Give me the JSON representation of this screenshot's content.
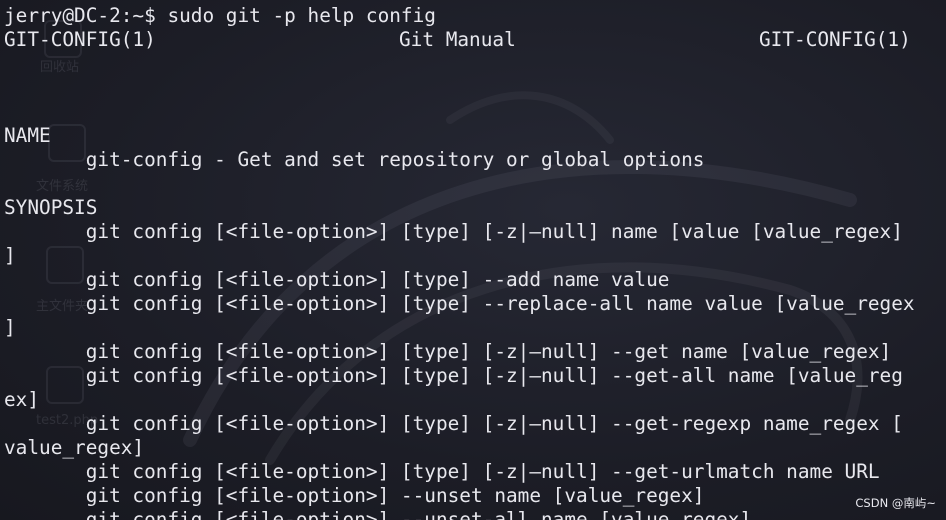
{
  "terminal": {
    "prompt_line": "jerry@DC-2:~$ sudo git -p help config",
    "header_left": "GIT-CONFIG(1)",
    "header_center": "Git Manual",
    "header_right": "GIT-CONFIG(1)",
    "lines": [
      "NAME",
      "       git-config - Get and set repository or global options",
      "",
      "SYNOPSIS",
      "       git config [<file-option>] [type] [-z|—null] name [value [value_regex]",
      "]",
      "       git config [<file-option>] [type] --add name value",
      "       git config [<file-option>] [type] --replace-all name value [value_regex",
      "]",
      "       git config [<file-option>] [type] [-z|—null] --get name [value_regex]",
      "       git config [<file-option>] [type] [-z|—null] --get-all name [value_reg",
      "ex]",
      "       git config [<file-option>] [type] [-z|—null] --get-regexp name_regex [",
      "value_regex]",
      "       git config [<file-option>] [type] [-z|—null] --get-urlmatch name URL",
      "       git config [<file-option>] --unset name [value_regex]",
      "       git config [<file-option>] --unset-all name [value_regex]"
    ]
  },
  "desktop_ghosts": [
    "回收站",
    "文件系统",
    "主文件夹",
    "test2.php"
  ],
  "watermark": "CSDN @南屿~"
}
